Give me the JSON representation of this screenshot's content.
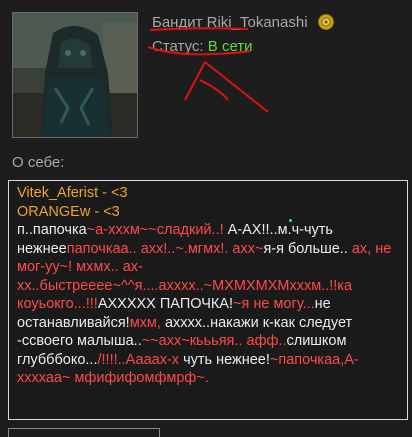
{
  "profile": {
    "username": "Бандит Riki_Tokanashi",
    "status_label": "Статус:",
    "status_value": "В сети",
    "about_label": "О себе:"
  },
  "about": {
    "line1": "Vitek_Aferist - <3",
    "line2": "ORANGEw - <3",
    "segments": [
      {
        "text": "п..папочка",
        "color": "white"
      },
      {
        "text": "~а-хххм~~сладкий..!",
        "color": "pink"
      },
      {
        "text": " А-АХ!!..м.ч-чуть нежнее",
        "color": "white"
      },
      {
        "text": "папочкаа.. ахх!..~.мгмх!. ахх~",
        "color": "pink"
      },
      {
        "text": "я-я больше..",
        "color": "white"
      },
      {
        "text": " ах, не мог-уу~! мхмх.. ах-хх..быстрееее~^^я....ахххх..~МХМХМХМхххм..!!ка коуьокго...!!!",
        "color": "pink"
      },
      {
        "text": "АХХХХХ ПАПОЧКА!",
        "color": "white"
      },
      {
        "text": "~я не могу...",
        "color": "pink"
      },
      {
        "text": "не останавливайся!",
        "color": "white"
      },
      {
        "text": "мхм,",
        "color": "pink"
      },
      {
        "text": " ахххх..накажи к-как следует -ссвоего малыша..",
        "color": "white"
      },
      {
        "text": "~~ахх~кьььяя.. афф..",
        "color": "pink"
      },
      {
        "text": "слишком глубббоко...",
        "color": "white"
      },
      {
        "text": "/!!!!..Аааах-х",
        "color": "pink"
      },
      {
        "text": " чуть нежнее!",
        "color": "white"
      },
      {
        "text": "~папочкаа,А-ххххаа~ мфифифомфмрф~.",
        "color": "pink"
      }
    ]
  },
  "colors": {
    "accent_status": "#5fdc3a",
    "orange": "#f0a42c",
    "pink": "#ff4a4a",
    "annotation_red": "#e01010"
  }
}
